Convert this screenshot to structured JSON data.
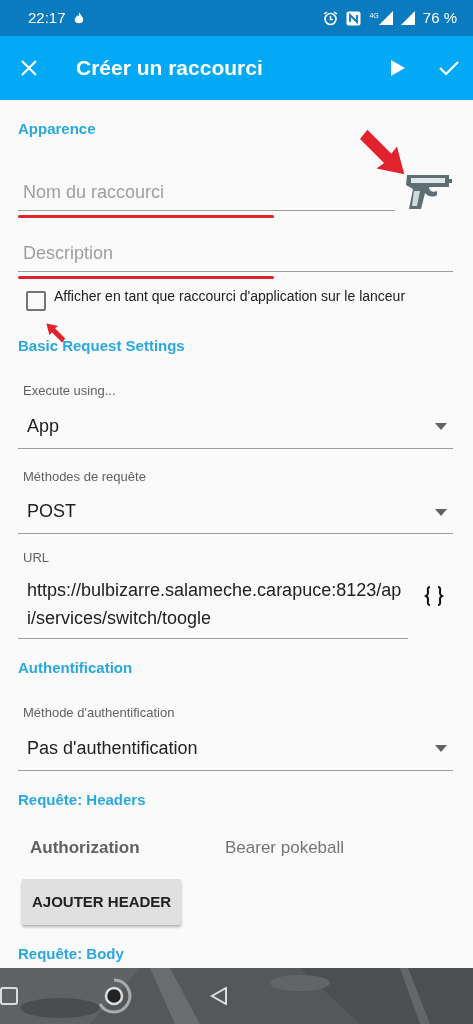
{
  "status_bar": {
    "time": "22:17",
    "network": "4G",
    "battery": "76 %"
  },
  "toolbar": {
    "title": "Créer un raccourci"
  },
  "sections": [
    {
      "title": "Apparence",
      "items": [
        {
          "kind": "text",
          "placeholder": "Nom du raccourci",
          "annotated": true
        },
        {
          "kind": "text",
          "placeholder": "Description",
          "annotated": true
        },
        {
          "kind": "checkbox",
          "label": "Afficher en tant que raccourci d'application sur le lanceur",
          "checked": false,
          "annotated": true
        }
      ]
    },
    {
      "title": "Basic Request Settings",
      "items": [
        {
          "kind": "select",
          "label": "Execute using...",
          "value": "App"
        },
        {
          "kind": "select",
          "label": "Méthodes de requête",
          "value": "POST"
        },
        {
          "kind": "url",
          "label": "URL",
          "value": "https://bulbizarre.salameche.carapuce:8123/api/services/switch/toogle"
        }
      ]
    },
    {
      "title": "Authentification",
      "items": [
        {
          "kind": "select",
          "label": "Méthode d'authentification",
          "value": "Pas d'authentification"
        }
      ]
    },
    {
      "title": "Requête: Headers",
      "items": [
        {
          "kind": "header",
          "name": "Authorization",
          "value": "Bearer pokeball"
        },
        {
          "kind": "button",
          "label": "AJOUTER HEADER"
        }
      ]
    },
    {
      "title": "Requête: Body"
    }
  ]
}
